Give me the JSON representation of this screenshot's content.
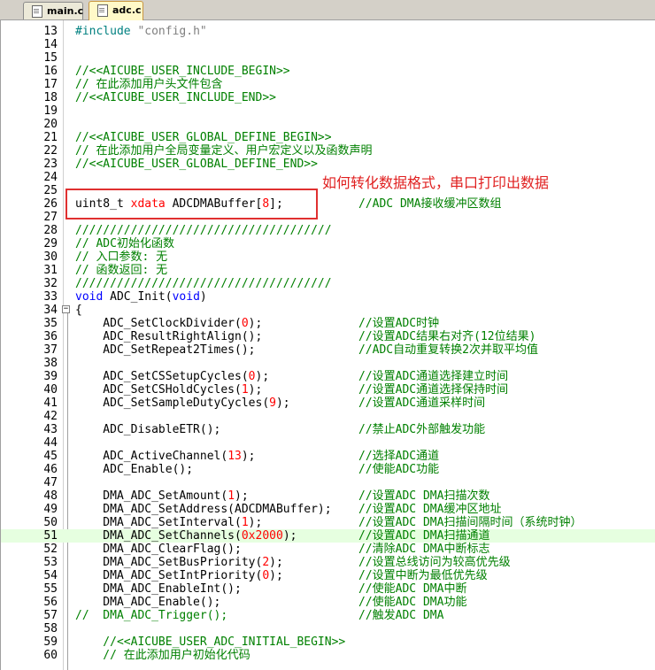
{
  "tabs": [
    {
      "label": "main.c",
      "active": false
    },
    {
      "label": "adc.c",
      "active": true
    }
  ],
  "annotation": "如何转化数据格式，串口打印出数据",
  "lines": [
    {
      "n": "13",
      "code": [
        [
          "pp",
          "#include "
        ],
        [
          "str",
          "\"config.h\""
        ]
      ]
    },
    {
      "n": "14",
      "code": []
    },
    {
      "n": "15",
      "code": []
    },
    {
      "n": "16",
      "code": [
        [
          "cmtc",
          "//<<AICUBE_USER_INCLUDE_BEGIN>>"
        ]
      ]
    },
    {
      "n": "17",
      "code": [
        [
          "cmtc",
          "// 在此添加用户头文件包含"
        ]
      ]
    },
    {
      "n": "18",
      "code": [
        [
          "cmtc",
          "//<<AICUBE_USER_INCLUDE_END>>"
        ]
      ]
    },
    {
      "n": "19",
      "code": []
    },
    {
      "n": "20",
      "code": []
    },
    {
      "n": "21",
      "code": [
        [
          "cmtc",
          "//<<AICUBE_USER_GLOBAL_DEFINE_BEGIN>>"
        ]
      ]
    },
    {
      "n": "22",
      "code": [
        [
          "cmtc",
          "// 在此添加用户全局变量定义、用户宏定义以及函数声明"
        ]
      ]
    },
    {
      "n": "23",
      "code": [
        [
          "cmtc",
          "//<<AICUBE_USER_GLOBAL_DEFINE_END>>"
        ]
      ]
    },
    {
      "n": "24",
      "code": []
    },
    {
      "n": "25",
      "code": []
    },
    {
      "n": "26",
      "code": [
        [
          "t",
          "uint8_t "
        ],
        [
          "num",
          "xdata"
        ],
        [
          "t",
          " ADCDMABuffer["
        ],
        [
          "num",
          "8"
        ],
        [
          "t",
          "];"
        ]
      ],
      "cmt": "//ADC DMA接收缓冲区数组"
    },
    {
      "n": "27",
      "code": []
    },
    {
      "n": "28",
      "code": [
        [
          "cmtc",
          "/////////////////////////////////////"
        ]
      ]
    },
    {
      "n": "29",
      "code": [
        [
          "cmtc",
          "// ADC初始化函数"
        ]
      ]
    },
    {
      "n": "30",
      "code": [
        [
          "cmtc",
          "// 入口参数: 无"
        ]
      ]
    },
    {
      "n": "31",
      "code": [
        [
          "cmtc",
          "// 函数返回: 无"
        ]
      ]
    },
    {
      "n": "32",
      "code": [
        [
          "cmtc",
          "/////////////////////////////////////"
        ]
      ]
    },
    {
      "n": "33",
      "code": [
        [
          "kw",
          "void"
        ],
        [
          "t",
          " ADC_Init("
        ],
        [
          "kw",
          "void"
        ],
        [
          "t",
          ")"
        ]
      ]
    },
    {
      "n": "34",
      "code": [
        [
          "t",
          "{"
        ]
      ],
      "fold": "−"
    },
    {
      "n": "35",
      "code": [
        [
          "t",
          "    ADC_SetClockDivider("
        ],
        [
          "num",
          "0"
        ],
        [
          "t",
          ");"
        ]
      ],
      "cmt": "//设置ADC时钟"
    },
    {
      "n": "36",
      "code": [
        [
          "t",
          "    ADC_ResultRightAlign();"
        ]
      ],
      "cmt": "//设置ADC结果右对齐(12位结果)"
    },
    {
      "n": "37",
      "code": [
        [
          "t",
          "    ADC_SetRepeat2Times();"
        ]
      ],
      "cmt": "//ADC自动重复转换2次并取平均值"
    },
    {
      "n": "38",
      "code": []
    },
    {
      "n": "39",
      "code": [
        [
          "t",
          "    ADC_SetCSSetupCycles("
        ],
        [
          "num",
          "0"
        ],
        [
          "t",
          ");"
        ]
      ],
      "cmt": "//设置ADC通道选择建立时间"
    },
    {
      "n": "40",
      "code": [
        [
          "t",
          "    ADC_SetCSHoldCycles("
        ],
        [
          "num",
          "1"
        ],
        [
          "t",
          ");"
        ]
      ],
      "cmt": "//设置ADC通道选择保持时间"
    },
    {
      "n": "41",
      "code": [
        [
          "t",
          "    ADC_SetSampleDutyCycles("
        ],
        [
          "num",
          "9"
        ],
        [
          "t",
          ");"
        ]
      ],
      "cmt": "//设置ADC通道采样时间"
    },
    {
      "n": "42",
      "code": []
    },
    {
      "n": "43",
      "code": [
        [
          "t",
          "    ADC_DisableETR();"
        ]
      ],
      "cmt": "//禁止ADC外部触发功能"
    },
    {
      "n": "44",
      "code": []
    },
    {
      "n": "45",
      "code": [
        [
          "t",
          "    ADC_ActiveChannel("
        ],
        [
          "num",
          "13"
        ],
        [
          "t",
          ");"
        ]
      ],
      "cmt": "//选择ADC通道"
    },
    {
      "n": "46",
      "code": [
        [
          "t",
          "    ADC_Enable();"
        ]
      ],
      "cmt": "//使能ADC功能"
    },
    {
      "n": "47",
      "code": []
    },
    {
      "n": "48",
      "code": [
        [
          "t",
          "    DMA_ADC_SetAmount("
        ],
        [
          "num",
          "1"
        ],
        [
          "t",
          ");"
        ]
      ],
      "cmt": "//设置ADC DMA扫描次数"
    },
    {
      "n": "49",
      "code": [
        [
          "t",
          "    DMA_ADC_SetAddress(ADCDMABuffer);"
        ]
      ],
      "cmt": "//设置ADC DMA缓冲区地址"
    },
    {
      "n": "50",
      "code": [
        [
          "t",
          "    DMA_ADC_SetInterval("
        ],
        [
          "num",
          "1"
        ],
        [
          "t",
          ");"
        ]
      ],
      "cmt": "//设置ADC DMA扫描间隔时间（系统时钟）"
    },
    {
      "n": "51",
      "code": [
        [
          "t",
          "    DMA_ADC_SetChannels("
        ],
        [
          "num",
          "0x2000"
        ],
        [
          "t",
          ");"
        ]
      ],
      "cmt": "//设置ADC DMA扫描通道",
      "hl": true
    },
    {
      "n": "52",
      "code": [
        [
          "t",
          "    DMA_ADC_ClearFlag();"
        ]
      ],
      "cmt": "//清除ADC DMA中断标志"
    },
    {
      "n": "53",
      "code": [
        [
          "t",
          "    DMA_ADC_SetBusPriority("
        ],
        [
          "num",
          "2"
        ],
        [
          "t",
          ");"
        ]
      ],
      "cmt": "//设置总线访问为较高优先级"
    },
    {
      "n": "54",
      "code": [
        [
          "t",
          "    DMA_ADC_SetIntPriority("
        ],
        [
          "num",
          "0"
        ],
        [
          "t",
          ");"
        ]
      ],
      "cmt": "//设置中断为最低优先级"
    },
    {
      "n": "55",
      "code": [
        [
          "t",
          "    DMA_ADC_EnableInt();"
        ]
      ],
      "cmt": "//使能ADC DMA中断"
    },
    {
      "n": "56",
      "code": [
        [
          "t",
          "    DMA_ADC_Enable();"
        ]
      ],
      "cmt": "//使能ADC DMA功能"
    },
    {
      "n": "57",
      "code": [
        [
          "cmtc",
          "//  DMA_ADC_Trigger();"
        ]
      ],
      "cmt": "//触发ADC DMA"
    },
    {
      "n": "58",
      "code": []
    },
    {
      "n": "59",
      "code": [
        [
          "cmtc",
          "    //<<AICUBE_USER_ADC_INITIAL_BEGIN>>"
        ]
      ]
    },
    {
      "n": "60",
      "code": [
        [
          "cmtc",
          "    // 在此添加用户初始化代码"
        ]
      ]
    }
  ]
}
